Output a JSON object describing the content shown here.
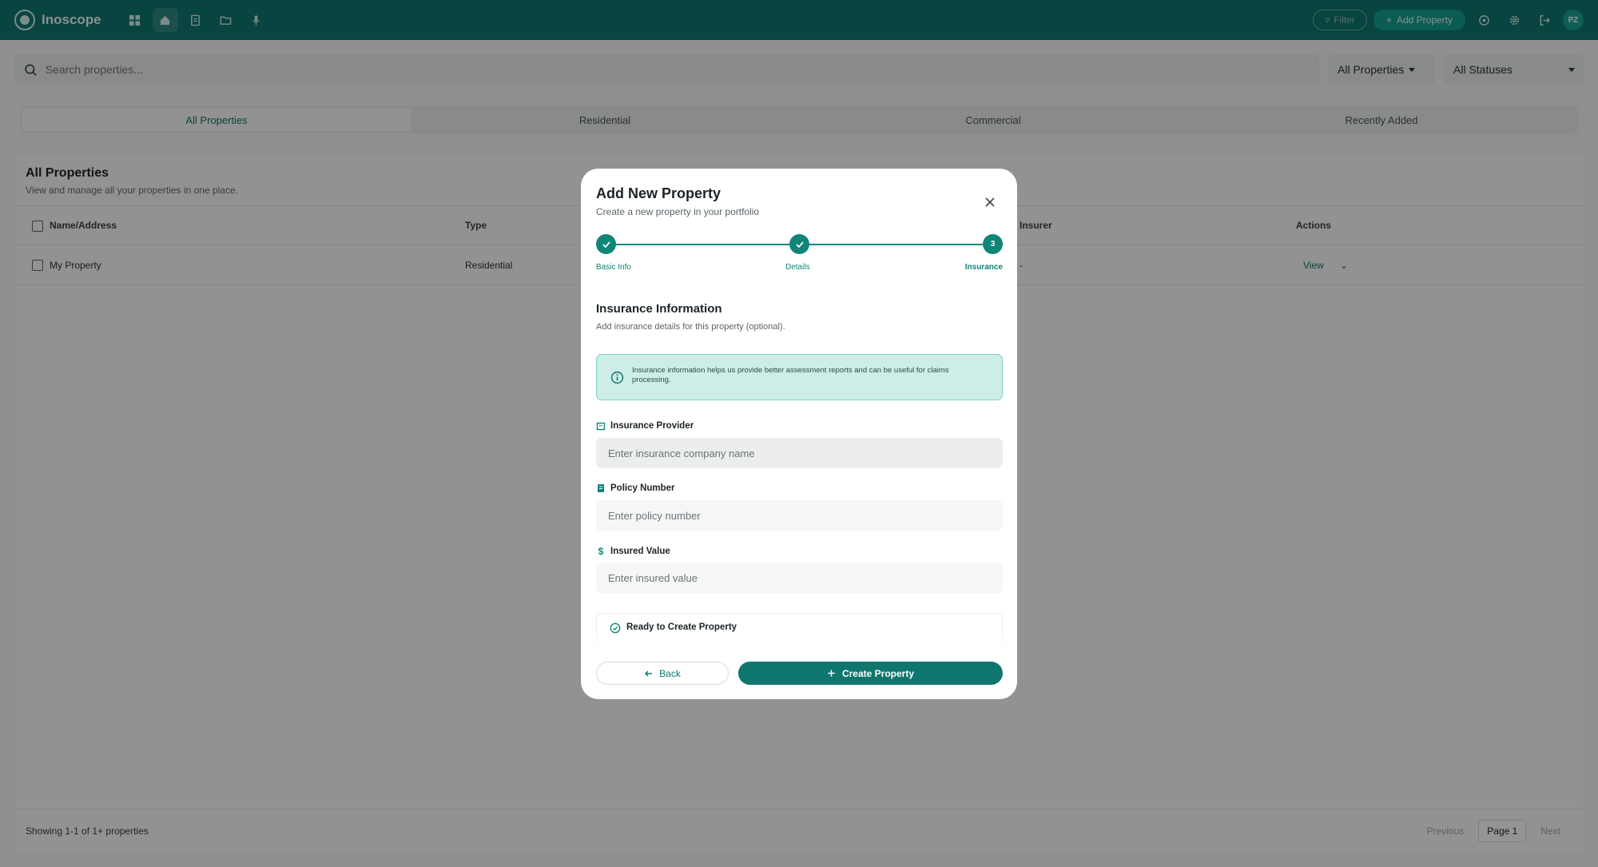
{
  "app": {
    "name": "Inoscope",
    "user_initials": "PZ"
  },
  "topbar": {
    "filter_label": "Filter",
    "add_property_label": "Add Property"
  },
  "search": {
    "placeholder": "Search properties..."
  },
  "filters": {
    "properties_select": "All Properties",
    "status_select": "All Statuses"
  },
  "tabs": [
    "All Properties",
    "Residential",
    "Commercial",
    "Recently Added"
  ],
  "properties_card": {
    "title": "All Properties",
    "subtitle": "View and manage all your properties in one place.",
    "columns": {
      "name": "Name/Address",
      "type": "Type",
      "insurer": "Insurer",
      "actions": "Actions"
    },
    "rows": [
      {
        "name": "My Property",
        "type": "Residential",
        "insurer": "-",
        "action": "View"
      }
    ],
    "footer": {
      "showing": "Showing 1-1 of 1+ properties",
      "previous": "Previous",
      "page": "Page 1",
      "next": "Next"
    }
  },
  "modal": {
    "title": "Add New Property",
    "subtitle": "Create a new property in your portfolio",
    "steps": [
      {
        "label": "Basic Info",
        "state": "done"
      },
      {
        "label": "Details",
        "state": "done"
      },
      {
        "label": "Insurance",
        "number": "3",
        "state": "current"
      }
    ],
    "section_title": "Insurance Information",
    "section_subtitle": "Add insurance details for this property (optional).",
    "info_text": "Insurance information helps us provide better assessment reports and can be useful for claims processing.",
    "fields": {
      "provider": {
        "label": "Insurance Provider",
        "placeholder": "Enter insurance company name",
        "value": ""
      },
      "policy": {
        "label": "Policy Number",
        "placeholder": "Enter policy number",
        "value": ""
      },
      "insured_value": {
        "label": "Insured Value",
        "placeholder": "Enter insured value",
        "value": ""
      }
    },
    "ready_title": "Ready to Create Property",
    "back_label": "Back",
    "create_label": "Create Property"
  },
  "colors": {
    "brand": "#0f766e",
    "accent": "#13a08f",
    "info_bg": "#cdeee6"
  }
}
